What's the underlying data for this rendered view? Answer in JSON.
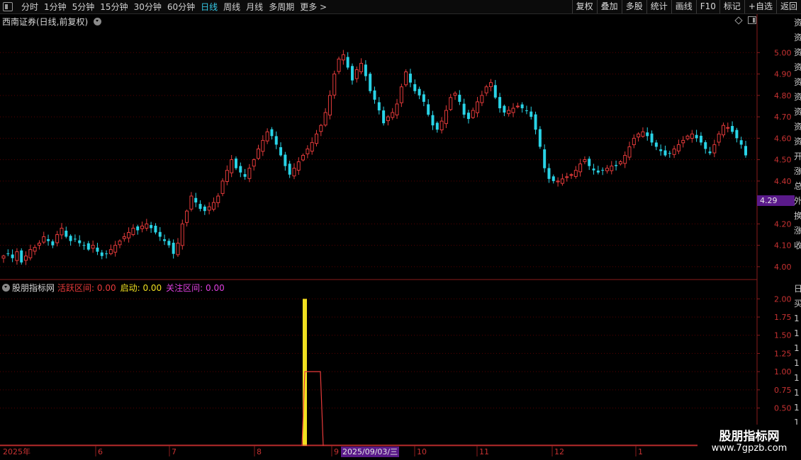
{
  "toolbar": {
    "period_tabs": [
      "分时",
      "1分钟",
      "5分钟",
      "15分钟",
      "30分钟",
      "60分钟",
      "日线",
      "周线",
      "月线",
      "多周期",
      "更多 >"
    ],
    "active_tab": "日线",
    "right_buttons": [
      "复权",
      "叠加",
      "多股",
      "统计",
      "画线",
      "F10",
      "标记",
      "+自选",
      "返回"
    ]
  },
  "main_chart": {
    "title": "西南证券(日线,前复权)",
    "current_price_tag": "4.29",
    "colors": {
      "up": "#e33a3a",
      "down": "#29d3e6",
      "grid": "#5a0000",
      "axis": "#8a1c1c"
    }
  },
  "indicator": {
    "name": "股朋指标网",
    "label_a": "活跃区间: 0.00",
    "label_b": "启动: 0.00",
    "label_c": "关注区间: 0.00",
    "colors": {
      "a": "#e83a3a",
      "b": "#f0e020",
      "c": "#e040e0"
    }
  },
  "x_axis": {
    "labels": [
      "2025年",
      "6",
      "7",
      "8",
      "9",
      "10",
      "11",
      "12",
      "1"
    ],
    "cursor_date": "2025/09/03/三"
  },
  "watermark": {
    "title": "股朋指标网",
    "url": "www.7gpzb.com"
  },
  "right_edge_chars": [
    "资",
    "资",
    "资",
    "资",
    "资",
    "资",
    "资",
    "资",
    "资",
    "开",
    "涨",
    "总",
    "外",
    "换",
    "涨",
    "收"
  ],
  "right_edge_chars2": [
    "日",
    "买",
    "1",
    "1",
    "1",
    "1",
    "1",
    "1",
    "1",
    "1"
  ],
  "chart_data": [
    {
      "type": "candlestick",
      "title": "西南证券(日线,前复权)",
      "y_ticks": [
        5.0,
        4.9,
        4.8,
        4.7,
        4.6,
        4.5,
        4.4,
        4.29,
        4.2,
        4.1,
        4.0
      ],
      "ylim": [
        3.95,
        5.12
      ],
      "x_labels": [
        "2025年",
        "6",
        "7",
        "8",
        "9",
        "10",
        "11",
        "12",
        "1"
      ],
      "close_series": [
        4.05,
        4.06,
        4.04,
        4.07,
        4.02,
        4.05,
        4.08,
        4.09,
        4.11,
        4.14,
        4.12,
        4.1,
        4.15,
        4.18,
        4.14,
        4.12,
        4.13,
        4.11,
        4.1,
        4.08,
        4.1,
        4.07,
        4.05,
        4.06,
        4.08,
        4.1,
        4.12,
        4.14,
        4.16,
        4.18,
        4.17,
        4.19,
        4.2,
        4.18,
        4.16,
        4.14,
        4.12,
        4.1,
        4.06,
        4.11,
        4.2,
        4.26,
        4.33,
        4.3,
        4.27,
        4.26,
        4.28,
        4.3,
        4.33,
        4.4,
        4.45,
        4.5,
        4.46,
        4.44,
        4.42,
        4.46,
        4.5,
        4.55,
        4.59,
        4.63,
        4.61,
        4.57,
        4.52,
        4.47,
        4.43,
        4.46,
        4.49,
        4.52,
        4.55,
        4.58,
        4.62,
        4.66,
        4.72,
        4.8,
        4.9,
        4.97,
        4.99,
        4.93,
        4.87,
        4.92,
        4.95,
        4.89,
        4.82,
        4.78,
        4.73,
        4.67,
        4.7,
        4.72,
        4.76,
        4.84,
        4.91,
        4.86,
        4.82,
        4.8,
        4.77,
        4.71,
        4.66,
        4.64,
        4.68,
        4.73,
        4.79,
        4.81,
        4.77,
        4.71,
        4.69,
        4.73,
        4.77,
        4.8,
        4.84,
        4.86,
        4.79,
        4.74,
        4.72,
        4.73,
        4.74,
        4.75,
        4.74,
        4.73,
        4.7,
        4.64,
        4.56,
        4.46,
        4.41,
        4.4,
        4.4,
        4.41,
        4.42,
        4.43,
        4.45,
        4.48,
        4.5,
        4.47,
        4.45,
        4.44,
        4.45,
        4.46,
        4.47,
        4.47,
        4.49,
        4.52,
        4.56,
        4.6,
        4.62,
        4.63,
        4.61,
        4.58,
        4.56,
        4.54,
        4.52,
        4.53,
        4.55,
        4.57,
        4.59,
        4.61,
        4.62,
        4.6,
        4.58,
        4.55,
        4.53,
        4.57,
        4.62,
        4.66,
        4.65,
        4.63,
        4.6,
        4.57,
        4.52
      ]
    },
    {
      "type": "bar",
      "title": "股朋指标网",
      "y_ticks": [
        2.0,
        1.75,
        1.5,
        1.25,
        1.0,
        0.75,
        0.5
      ],
      "ylim": [
        0,
        2.1
      ],
      "series": [
        {
          "name": "启动",
          "color": "#f0e020",
          "event_date": "2025/09/03",
          "value": 2.0
        },
        {
          "name": "活跃区间",
          "color": "#e83a3a",
          "step_value": 1.0,
          "step_length_bars": 4
        }
      ]
    }
  ]
}
